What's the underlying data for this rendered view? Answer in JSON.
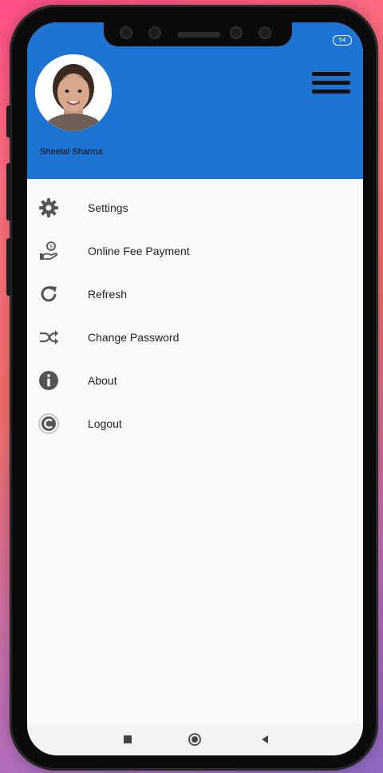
{
  "status_bar": {
    "battery": "54"
  },
  "profile": {
    "name": "Sheetal Sharma"
  },
  "menu": {
    "items": [
      {
        "label": "Settings",
        "icon": "gear-icon"
      },
      {
        "label": "Online Fee Payment",
        "icon": "fee-payment-icon"
      },
      {
        "label": "Refresh",
        "icon": "refresh-icon"
      },
      {
        "label": "Change Password",
        "icon": "shuffle-icon"
      },
      {
        "label": "About",
        "icon": "info-icon"
      },
      {
        "label": "Logout",
        "icon": "logout-icon"
      }
    ]
  },
  "colors": {
    "header": "#1d74d3",
    "icon": "#555555"
  }
}
